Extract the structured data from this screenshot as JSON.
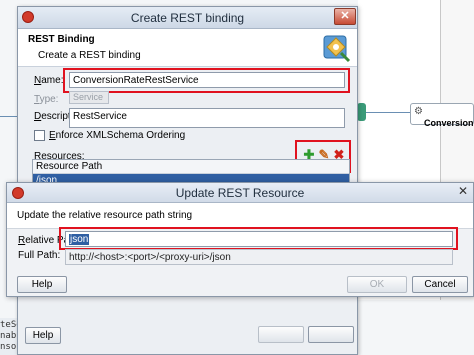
{
  "background": {
    "left_strip_lines": [
      "teSer",
      "nab.c",
      "nsou"
    ],
    "service_label": "ConversionRate"
  },
  "main_dialog": {
    "title": "Create REST binding",
    "close_glyph": "✕",
    "header_title": "REST Binding",
    "header_subtitle": "Create a REST binding",
    "name_label": "Name:",
    "name_value": "ConversionRateRestService",
    "type_label": "Type:",
    "type_value": "Service",
    "description_label": "Description:",
    "description_value": "RestService",
    "enforce_label": "Enforce XMLSchema Ordering",
    "resources_label": "Resources:",
    "table_header": "Resource Path",
    "table_rows": [
      "/json"
    ],
    "help_button": "Help",
    "add_icon": "plus-icon",
    "edit_icon": "pencil-icon",
    "delete_icon": "x-icon"
  },
  "update_dialog": {
    "title": "Update REST Resource",
    "close_glyph": "✕",
    "description": "Update the relative resource path string",
    "relative_path_label": "Relative Path:",
    "relative_path_value": "json",
    "full_path_label": "Full Path:",
    "full_path_value": "http://<host>:<port>/<proxy-uri>/json",
    "help_button": "Help",
    "ok_button": "OK",
    "cancel_button": "Cancel"
  },
  "colors": {
    "highlight_red": "#e0121f",
    "selection_blue": "#2f5fa3",
    "add_green": "#2e9b2e",
    "edit_orange": "#c86a1e",
    "delete_red": "#d0201a"
  }
}
